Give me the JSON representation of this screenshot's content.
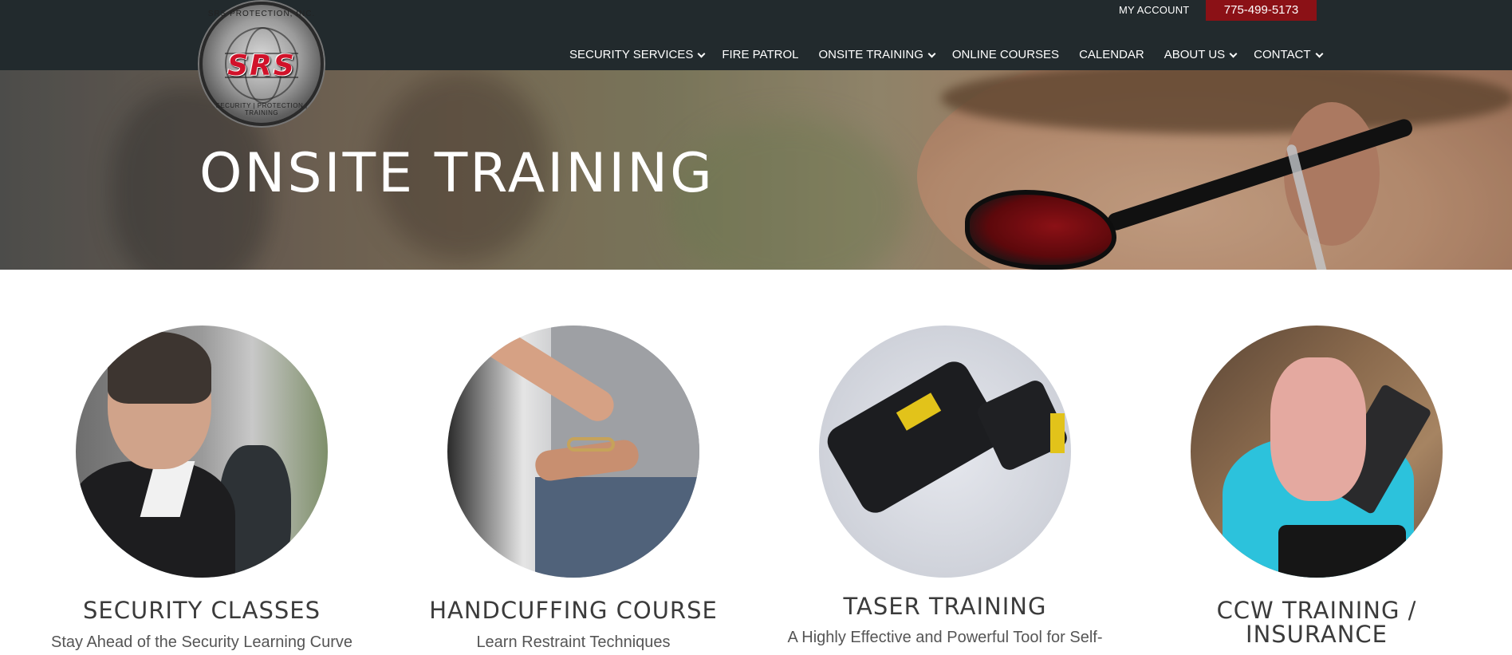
{
  "header": {
    "logo": {
      "ring_top": "SRS PROTECTION, INC.",
      "mark": "SRS",
      "ring_bottom": "SECURITY | PROTECTION | TRAINING"
    },
    "my_account": "MY ACCOUNT",
    "phone": "775-499-5173",
    "nav": [
      {
        "label": "SECURITY SERVICES",
        "has_dropdown": true
      },
      {
        "label": "FIRE PATROL",
        "has_dropdown": false
      },
      {
        "label": "ONSITE TRAINING",
        "has_dropdown": true
      },
      {
        "label": "ONLINE COURSES",
        "has_dropdown": false
      },
      {
        "label": "CALENDAR",
        "has_dropdown": false
      },
      {
        "label": "ABOUT US",
        "has_dropdown": true
      },
      {
        "label": "CONTACT",
        "has_dropdown": true
      }
    ]
  },
  "hero": {
    "title": "ONSITE TRAINING"
  },
  "cards": [
    {
      "title": "SECURITY CLASSES",
      "subtitle": "Stay Ahead of the Security Learning Curve"
    },
    {
      "title": "HANDCUFFING COURSE",
      "subtitle": "Learn Restraint Techniques"
    },
    {
      "title": "TASER TRAINING",
      "subtitle": "A Highly Effective and Powerful Tool for Self-"
    },
    {
      "title_line1": "CCW TRAINING /",
      "title_line2": "INSURANCE"
    }
  ],
  "colors": {
    "header_bg": "#222a2d",
    "phone_bg": "#8b1116",
    "logo_red": "#d1122a"
  }
}
